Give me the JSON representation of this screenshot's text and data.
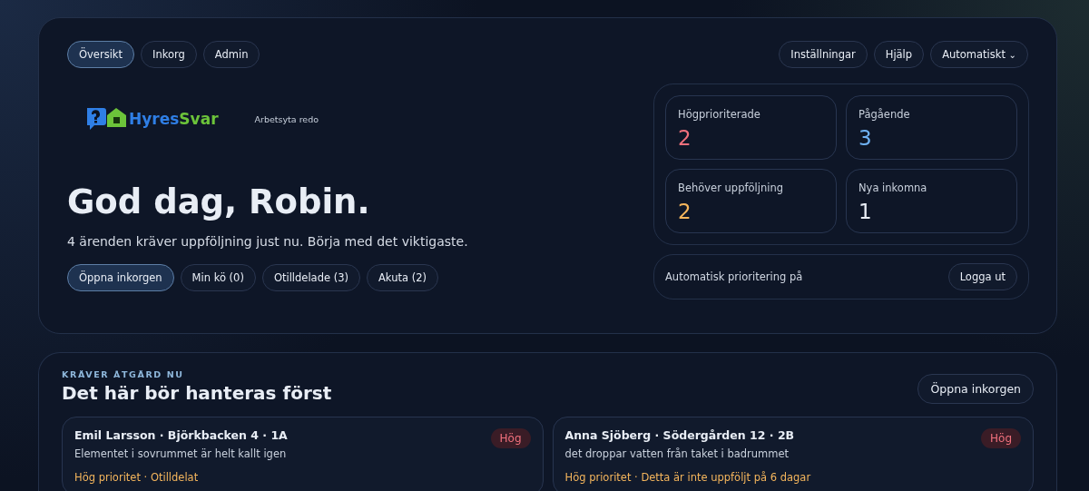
{
  "nav": {
    "tabs": [
      {
        "label": "Översikt",
        "selected": true
      },
      {
        "label": "Inkorg",
        "selected": false
      },
      {
        "label": "Admin",
        "selected": false
      }
    ],
    "actions": [
      "Inställningar",
      "Hjälp"
    ],
    "mode_dropdown": {
      "value": "Automatiskt",
      "caret": "⌄"
    }
  },
  "logo": {
    "parts": [
      {
        "text": "Hyres",
        "color": "#2f7fe6"
      },
      {
        "text": "Svar",
        "color": "#6cc43a"
      }
    ]
  },
  "workspace_status": "Arbetsyta redo",
  "greeting": "God dag, Robin.",
  "summary": "4 ärenden kräver uppföljning just nu. Börja med det viktigaste.",
  "quick_filters": [
    {
      "label": "Öppna inkorgen",
      "selected": true
    },
    {
      "label": "Min kö (0)",
      "selected": false
    },
    {
      "label": "Otilldelade (3)",
      "selected": false
    },
    {
      "label": "Akuta (2)",
      "selected": false
    }
  ],
  "stats": [
    {
      "label": "Högprioriterade",
      "value": "2",
      "color": "#f0707c"
    },
    {
      "label": "Pågående",
      "value": "3",
      "color": "#6fb2f5"
    },
    {
      "label": "Behöver uppföljning",
      "value": "2",
      "color": "#f4b55c"
    },
    {
      "label": "Nya inkomna",
      "value": "1",
      "color": "#e8edf5"
    }
  ],
  "auto_priority": {
    "text": "Automatisk prioritering på",
    "button": "Logga ut"
  },
  "urgent": {
    "eyebrow": "KRÄVER ÅTGÄRD NU",
    "title": "Det här bör hanteras först",
    "button": "Öppna inkorgen",
    "cases": [
      {
        "title": "Emil Larsson · Björkbacken 4 · 1A",
        "description": "Elementet i sovrummet är helt kallt igen",
        "priority": "Hög",
        "meta": "Hög prioritet · Otilldelat"
      },
      {
        "title": "Anna Sjöberg · Södergården 12 · 2B",
        "description": "det droppar vatten från taket i badrummet",
        "priority": "Hög",
        "meta": "Hög prioritet · Detta är inte uppföljt på 6 dagar"
      }
    ]
  }
}
